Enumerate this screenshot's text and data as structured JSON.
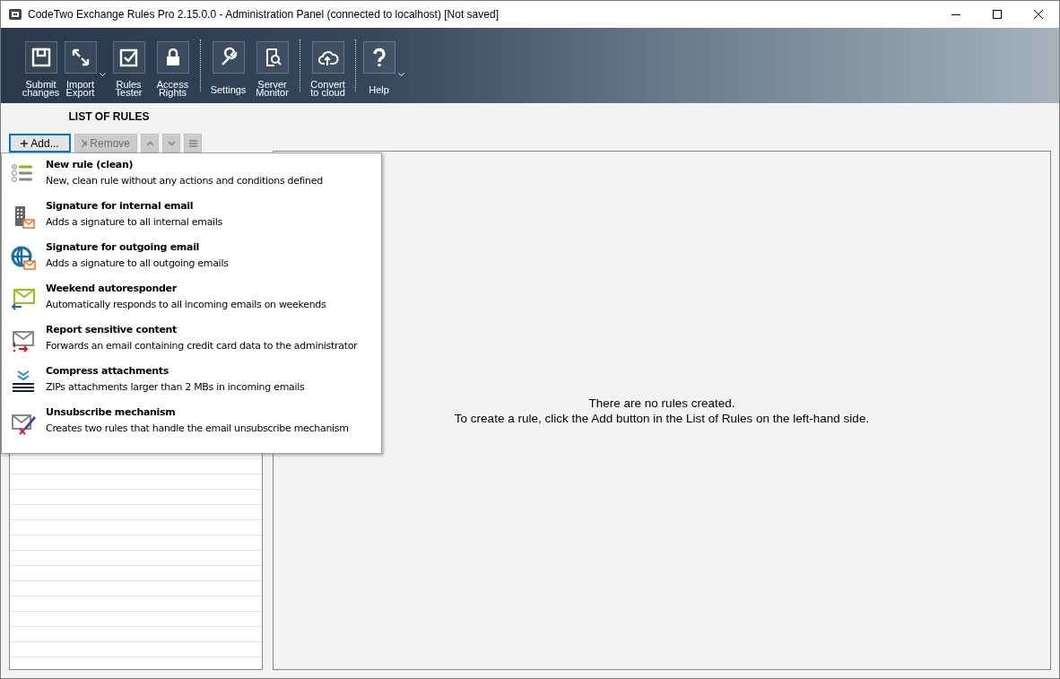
{
  "window": {
    "title": "CodeTwo Exchange Rules Pro 2.15.0.0 - Administration Panel (connected to localhost) [Not saved]"
  },
  "toolbar": {
    "groups": [
      [
        {
          "label": "Submit changes",
          "dropdown": false
        },
        {
          "label": "Import Export",
          "dropdown": true
        },
        {
          "label": "Rules Tester",
          "dropdown": false
        },
        {
          "label": "Access Rights",
          "dropdown": false
        }
      ],
      [
        {
          "label": "Settings",
          "dropdown": false
        },
        {
          "label": "Server Monitor",
          "dropdown": false
        }
      ],
      [
        {
          "label": "Convert to cloud",
          "dropdown": false
        }
      ],
      [
        {
          "label": "Help",
          "dropdown": true
        }
      ]
    ]
  },
  "rules_panel": {
    "title": "LIST OF RULES",
    "buttons": [
      {
        "kind": "text",
        "label": "Add...",
        "disabled": false
      },
      {
        "kind": "text",
        "label": "Remove",
        "disabled": true
      },
      {
        "kind": "up",
        "disabled": true
      },
      {
        "kind": "down",
        "disabled": true
      },
      {
        "kind": "menu",
        "disabled": true
      }
    ]
  },
  "add_menu": {
    "items": [
      {
        "title": "New rule (clean)",
        "description": "New, clean rule without any actions and conditions defined"
      },
      {
        "title": "Signature for internal email",
        "description": "Adds a signature to all internal emails"
      },
      {
        "title": "Signature for outgoing email",
        "description": "Adds a signature to all outgoing emails"
      },
      {
        "title": "Weekend autoresponder",
        "description": "Automatically responds to all incoming emails on weekends"
      },
      {
        "title": "Report sensitive content",
        "description": "Forwards an email containing credit card data to the administrator"
      },
      {
        "title": "Compress attachments",
        "description": "ZIPs attachments larger than 2 MBs in incoming emails"
      },
      {
        "title": "Unsubscribe mechanism",
        "description": "Creates two rules that handle the email unsubscribe mechanism"
      }
    ]
  },
  "main_panel": {
    "message": [
      "There are no rules created.",
      "To create a rule, click the Add button in the List of Rules on the left-hand side."
    ]
  }
}
